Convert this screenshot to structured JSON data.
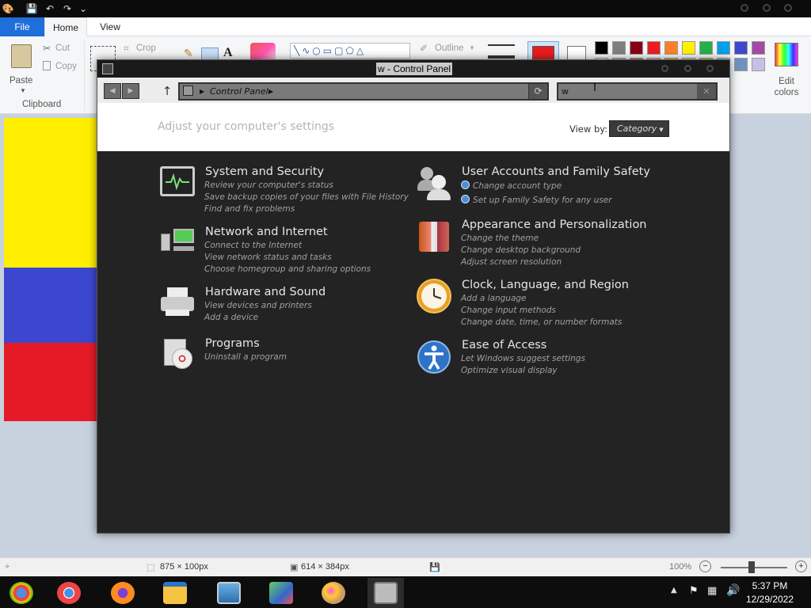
{
  "paint": {
    "menu": {
      "file": "File",
      "home": "Home",
      "view": "View"
    },
    "ribbon": {
      "paste": "Paste",
      "cut": "Cut",
      "copy": "Copy",
      "crop": "Crop",
      "clipboard_group": "Clipboard",
      "outline": "Outline",
      "edit_colors": "Edit colors"
    },
    "palette": [
      "#000000",
      "#7f7f7f",
      "#880015",
      "#ed1c24",
      "#ff7f27",
      "#fff200",
      "#22b14c",
      "#00a2e8",
      "#3f48cc",
      "#a349a4"
    ],
    "palette_row2": [
      "#ffffff",
      "#c3c3c3",
      "#b97a57",
      "#ffaec9",
      "#ffc90e",
      "#efe4b0",
      "#b5e61d",
      "#99d9ea",
      "#7092be",
      "#c8bfe7"
    ],
    "color1": "#e81d1d",
    "flag_colors": [
      "#ffee00",
      "#3c47cf",
      "#e41b26"
    ],
    "status": {
      "selection_size": "875 × 100px",
      "image_size": "614 × 384px",
      "zoom": "100%"
    }
  },
  "control_panel": {
    "title": "w - Control Panel",
    "breadcrumb": "Control Panel",
    "search_value": "w",
    "heading": "Adjust your computer's settings",
    "view_by_label": "View by:",
    "view_by_value": "Category",
    "categories": [
      {
        "title": "System and Security",
        "icon": "monitor-pulse-icon",
        "links": [
          "Review your computer's status",
          "Save backup copies of your files with File History",
          "Find and fix problems"
        ]
      },
      {
        "title": "Network and Internet",
        "icon": "network-computers-icon",
        "links": [
          "Connect to the Internet",
          "View network status and tasks",
          "Choose homegroup and sharing options"
        ]
      },
      {
        "title": "Hardware and Sound",
        "icon": "printer-icon",
        "links": [
          "View devices and printers",
          "Add a device"
        ]
      },
      {
        "title": "Programs",
        "icon": "programs-disc-icon",
        "links": [
          "Uninstall a program"
        ]
      },
      {
        "title": "User Accounts and Family Safety",
        "icon": "users-icon",
        "links": [
          "Change account type",
          "Set up Family Safety for any user"
        ]
      },
      {
        "title": "Appearance and Personalization",
        "icon": "personalization-icon",
        "links": [
          "Change the theme",
          "Change desktop background",
          "Adjust screen resolution"
        ]
      },
      {
        "title": "Clock, Language, and Region",
        "icon": "clock-icon",
        "links": [
          "Add a language",
          "Change input methods",
          "Change date, time, or number formats"
        ]
      },
      {
        "title": "Ease of Access",
        "icon": "accessibility-icon",
        "links": [
          "Let Windows suggest settings",
          "Optimize visual display"
        ]
      }
    ]
  },
  "taskbar": {
    "apps": [
      "chrome-remote-icon",
      "chrome-icon",
      "firefox-icon",
      "file-explorer-icon",
      "photos-icon",
      "network-app-icon",
      "paint-icon",
      "control-panel-icon"
    ],
    "time": "5:37 PM",
    "date": "12/29/2022"
  }
}
